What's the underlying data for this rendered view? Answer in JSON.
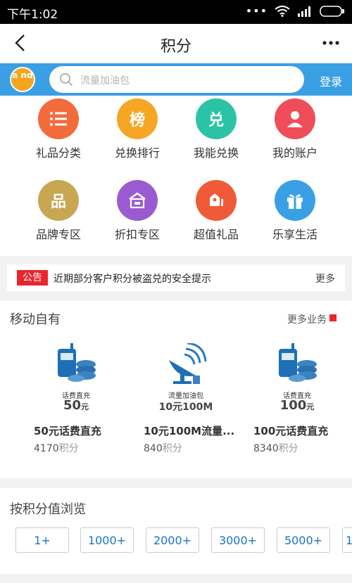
{
  "status_bar": {
    "time": "下午1:02"
  },
  "header": {
    "title": "积分"
  },
  "search": {
    "logo_text": "a nd",
    "placeholder": "流量加油包",
    "login_label": "登录"
  },
  "grid_items": [
    {
      "label": "礼品分类",
      "icon": "list-icon",
      "color": "#f26b3a",
      "glyph": "☰"
    },
    {
      "label": "兑换排行",
      "icon": "ranking-icon",
      "color": "#f5a623",
      "glyph": "榜"
    },
    {
      "label": "我能兑换",
      "icon": "redeem-icon",
      "color": "#2bc3a5",
      "glyph": "兑"
    },
    {
      "label": "我的账户",
      "icon": "user-icon",
      "color": "#ef4d5a",
      "glyph": ""
    },
    {
      "label": "品牌专区",
      "icon": "brand-icon",
      "color": "#c9a652",
      "glyph": "品"
    },
    {
      "label": "折扣专区",
      "icon": "discount-icon",
      "color": "#9b5bd0",
      "glyph": ""
    },
    {
      "label": "超值礼品",
      "icon": "gift-hand-icon",
      "color": "#f05a38",
      "glyph": ""
    },
    {
      "label": "乐享生活",
      "icon": "gift-box-icon",
      "color": "#3aa0e6",
      "glyph": ""
    }
  ],
  "notice": {
    "badge": "公告",
    "text": "近期部分客户积分被盗兑的安全提示",
    "more": "更多"
  },
  "section": {
    "title": "移动自有",
    "more": "更多业务",
    "products": [
      {
        "img_caption": "话费直充",
        "img_amount": "50",
        "img_unit": "元",
        "name": "50元话费直充",
        "points": "4170",
        "points_unit": "积分"
      },
      {
        "img_caption": "流量加油包",
        "img_amount": "10元100M",
        "img_unit": "",
        "name": "10元100M流量...",
        "points": "840",
        "points_unit": "积分"
      },
      {
        "img_caption": "话费直充",
        "img_amount": "100",
        "img_unit": "元",
        "name": "100元话费直充",
        "points": "8340",
        "points_unit": "积分"
      }
    ]
  },
  "browse": {
    "title": "按积分值浏览",
    "filters": [
      "1+",
      "1000+",
      "2000+",
      "3000+",
      "5000+",
      "1"
    ]
  }
}
